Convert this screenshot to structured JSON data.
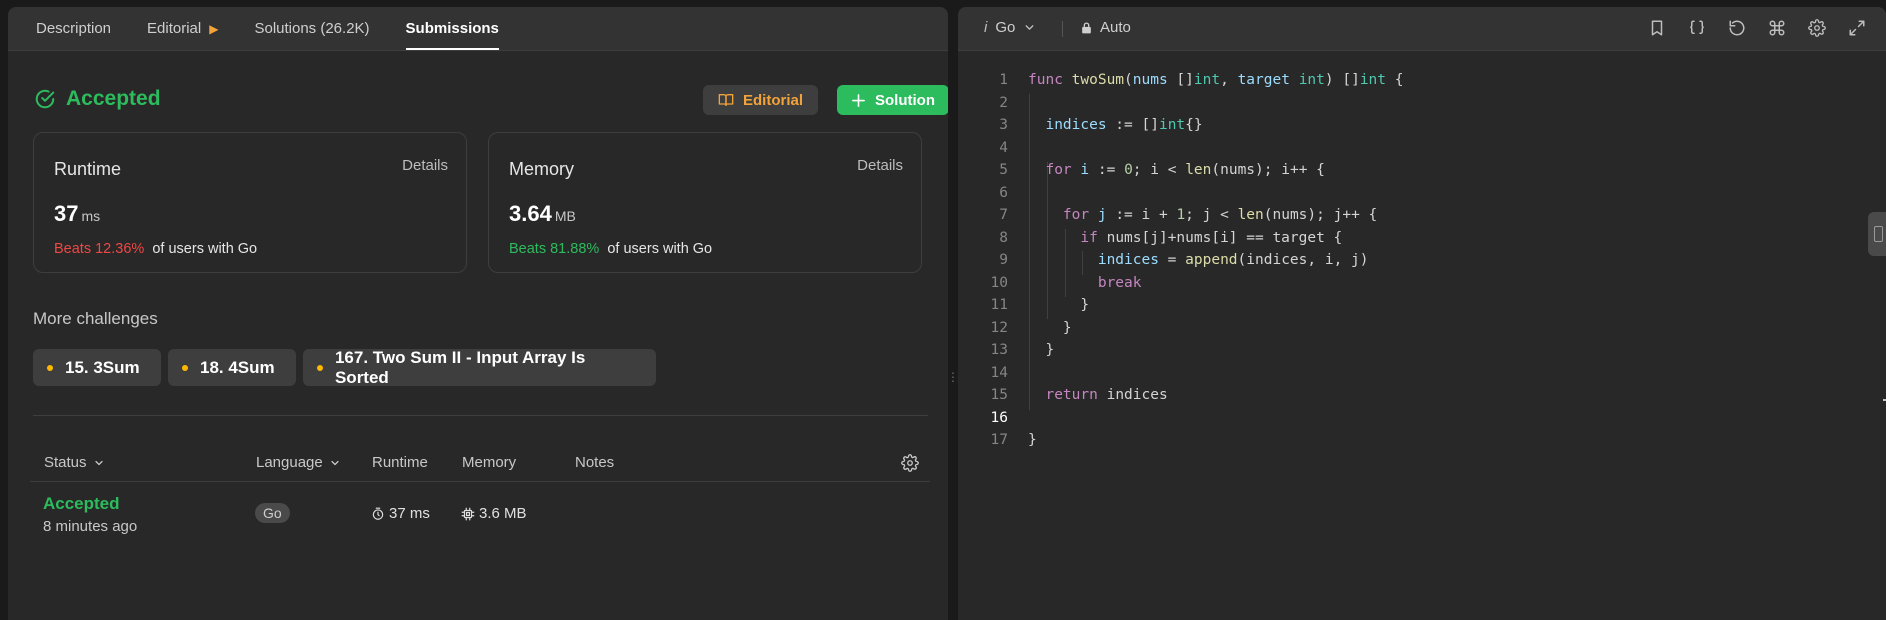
{
  "tabs": [
    {
      "label": "Description"
    },
    {
      "label": "Editorial"
    },
    {
      "label": "Solutions (26.2K)"
    },
    {
      "label": "Submissions"
    }
  ],
  "result": {
    "status": "Accepted",
    "editorial_button": "Editorial",
    "solution_button": "Solution"
  },
  "runtime": {
    "label": "Runtime",
    "details": "Details",
    "value": "37",
    "unit": "ms",
    "beats": "Beats 12.36%",
    "suffix": "of users with Go"
  },
  "memory": {
    "label": "Memory",
    "details": "Details",
    "value": "3.64",
    "unit": "MB",
    "beats": "Beats 81.88%",
    "suffix": "of users with Go"
  },
  "challenges": {
    "title": "More challenges",
    "items": [
      "15. 3Sum",
      "18. 4Sum",
      "167. Two Sum II - Input Array Is Sorted"
    ]
  },
  "table": {
    "headers": {
      "status": "Status",
      "language": "Language",
      "runtime": "Runtime",
      "memory": "Memory",
      "notes": "Notes"
    },
    "rows": [
      {
        "status": "Accepted",
        "time": "8 minutes ago",
        "language": "Go",
        "runtime": "37 ms",
        "memory": "3.6 MB"
      }
    ]
  },
  "editor": {
    "language": "Go",
    "language_prefix": "i",
    "mode": "Auto",
    "line_numbers": [
      "1",
      "2",
      "3",
      "4",
      "5",
      "6",
      "7",
      "8",
      "9",
      "10",
      "11",
      "12",
      "13",
      "14",
      "15",
      "16",
      "17"
    ],
    "current_line": 16
  },
  "colors": {
    "accent_green": "#2cbb5d",
    "accent_orange": "#f2a33a",
    "accent_red": "#ef4743",
    "panel_bg": "#282828"
  }
}
